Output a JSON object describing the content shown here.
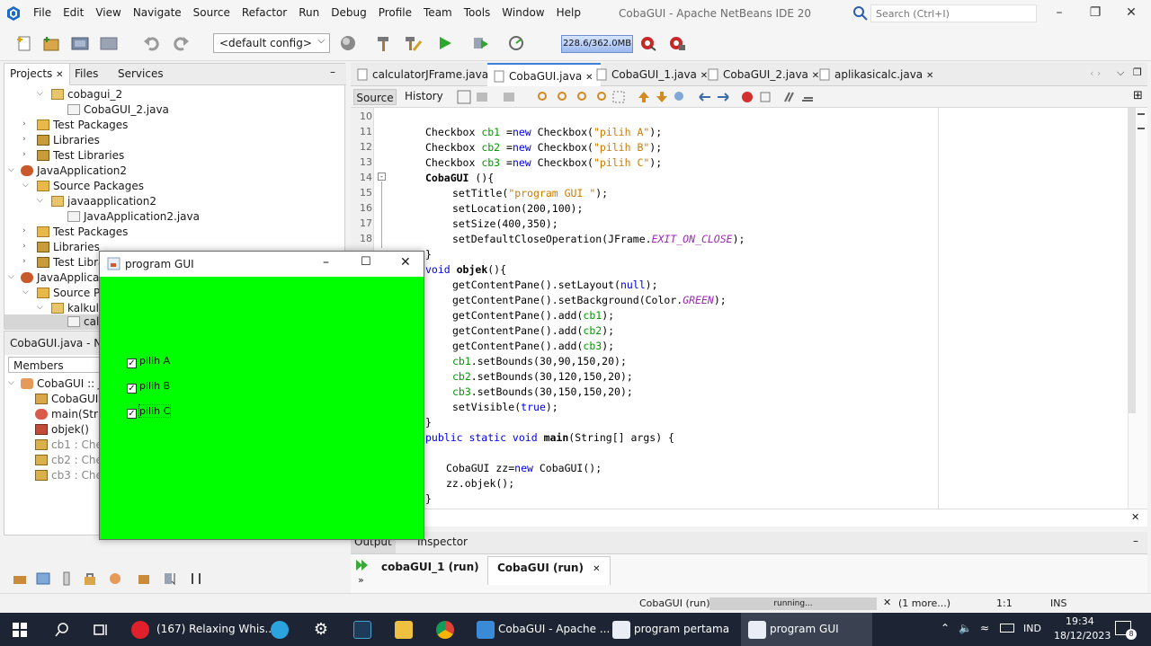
{
  "window": {
    "title": "CobaGUI - Apache NetBeans IDE 20",
    "menus": [
      "File",
      "Edit",
      "View",
      "Navigate",
      "Source",
      "Refactor",
      "Run",
      "Debug",
      "Profile",
      "Team",
      "Tools",
      "Window",
      "Help"
    ],
    "search_placeholder": "Search (Ctrl+I)"
  },
  "toolbar": {
    "config": "<default config>",
    "memory": "228.6/362.0MB"
  },
  "projects": {
    "tabs": [
      "Projects",
      "Files",
      "Services"
    ],
    "tree": [
      {
        "label": "cobagui_2",
        "icon": "package-icon"
      },
      {
        "label": "CobaGUI_2.java",
        "icon": "java-file-icon"
      },
      {
        "label": "Test Packages",
        "icon": "folder-icon"
      },
      {
        "label": "Libraries",
        "icon": "library-icon"
      },
      {
        "label": "Test Libraries",
        "icon": "library-icon"
      },
      {
        "label": "JavaApplication2",
        "icon": "project-icon"
      },
      {
        "label": "Source Packages",
        "icon": "folder-icon"
      },
      {
        "label": "javaapplication2",
        "icon": "package-icon"
      },
      {
        "label": "JavaApplication2.java",
        "icon": "java-file-icon"
      },
      {
        "label": "Test Packages",
        "icon": "folder-icon"
      },
      {
        "label": "Libraries",
        "icon": "library-icon"
      },
      {
        "label": "Test Libraries",
        "icon": "library-icon"
      },
      {
        "label": "JavaApplicati",
        "icon": "project-icon"
      },
      {
        "label": "Source Pa",
        "icon": "folder-icon"
      },
      {
        "label": "kalkula",
        "icon": "package-icon"
      },
      {
        "label": "cal",
        "icon": "java-file-icon"
      }
    ]
  },
  "navigator": {
    "title": "CobaGUI.java - Navi",
    "filter": "Members",
    "items": [
      {
        "label": "CobaGUI :: JF"
      },
      {
        "label": "CobaGUI("
      },
      {
        "label": "main(Strin"
      },
      {
        "label": "objek()"
      },
      {
        "label": "cb1 : Chec"
      },
      {
        "label": "cb2 : Chec"
      },
      {
        "label": "cb3 : Chec"
      }
    ]
  },
  "editor": {
    "tabs": [
      "calculatorJFrame.java",
      "CobaGUI.java",
      "CobaGUI_1.java",
      "CobaGUI_2.java",
      "aplikasicalc.java"
    ],
    "active_tab": "CobaGUI.java",
    "source_label": "Source",
    "history_label": "History",
    "line_numbers": [
      "10",
      "11",
      "12",
      "13",
      "14",
      "15",
      "16",
      "17",
      "18",
      "19",
      "20",
      "21",
      "22",
      "23",
      "24",
      "25",
      "26",
      "27",
      "28",
      "29",
      "30",
      "31",
      "32",
      "33",
      "34",
      "35",
      "36"
    ],
    "code": {
      "l11a": "Checkbox ",
      "l11b": "cb1",
      "l11c": " =",
      "l11d": "new",
      "l11e": " Checkbox(",
      "l11f": "\"pilih A\"",
      "l11g": ");",
      "l12a": "Checkbox ",
      "l12b": "cb2",
      "l12c": " =",
      "l12d": "new",
      "l12e": " Checkbox(",
      "l12f": "\"pilih B\"",
      "l12g": ");",
      "l13a": "Checkbox ",
      "l13b": "cb3",
      "l13c": " =",
      "l13d": "new",
      "l13e": " Checkbox(",
      "l13f": "\"pilih C\"",
      "l13g": ");",
      "l14": "CobaGUI ",
      "l14b": "(){",
      "l15a": "setTitle(",
      "l15b": "\"program GUI \"",
      "l15c": ");",
      "l16": "setLocation(200,100);",
      "l17": "setSize(400,350);",
      "l18a": "setDefaultCloseOperation(JFrame.",
      "l18b": "EXIT_ON_CLOSE",
      "l18c": ");",
      "l19": "}",
      "l20a": "void",
      "l20b": " objek",
      "l20c": "(){",
      "l21a": "getContentPane().setLayout(",
      "l21b": "null",
      "l21c": ");",
      "l22a": "getContentPane().setBackground(Color.",
      "l22b": "GREEN",
      "l22c": ");",
      "l23a": "getContentPane().add(",
      "l23b": "cb1",
      "l23c": ");",
      "l24a": "getContentPane().add(",
      "l24b": "cb2",
      "l24c": ");",
      "l25a": "getContentPane().add(",
      "l25b": "cb3",
      "l25c": ");",
      "l26a": "cb1",
      "l26b": ".setBounds(30,90,150,20);",
      "l27a": "cb2",
      "l27b": ".setBounds(30,120,150,20);",
      "l28a": "cb3",
      "l28b": ".setBounds(30,150,150,20);",
      "l29a": "setVisible(",
      "l29b": "true",
      "l29c": ");",
      "l30": "}",
      "l31a": "public static void ",
      "l31b": "main",
      "l31c": "(String[] args) {",
      "l33a": "CobaGUI zz=",
      "l33b": "new",
      "l33c": " CobaGUI();",
      "l34": "zz.objek();",
      "l35": "}"
    }
  },
  "output": {
    "tabs": [
      "Output",
      "Inspector"
    ],
    "run_tabs": [
      "cobaGUI_1 (run)",
      "CobaGUI (run)"
    ]
  },
  "status": {
    "task": "CobaGUI (run)",
    "progress": "running...",
    "more": "(1 more...)",
    "position": "1:1",
    "mode": "INS"
  },
  "gui_window": {
    "title": "program GUI",
    "checkboxes": [
      "pilih A",
      "pilih B",
      "pilih C"
    ],
    "colors": {
      "background": "#00ff00"
    }
  },
  "taskbar": {
    "items": [
      "(167) Relaxing Whis...",
      "CobaGUI - Apache ...",
      "program pertama",
      "program GUI"
    ],
    "lang": "IND",
    "time": "19:34",
    "date": "18/12/2023",
    "notif_count": "8"
  }
}
